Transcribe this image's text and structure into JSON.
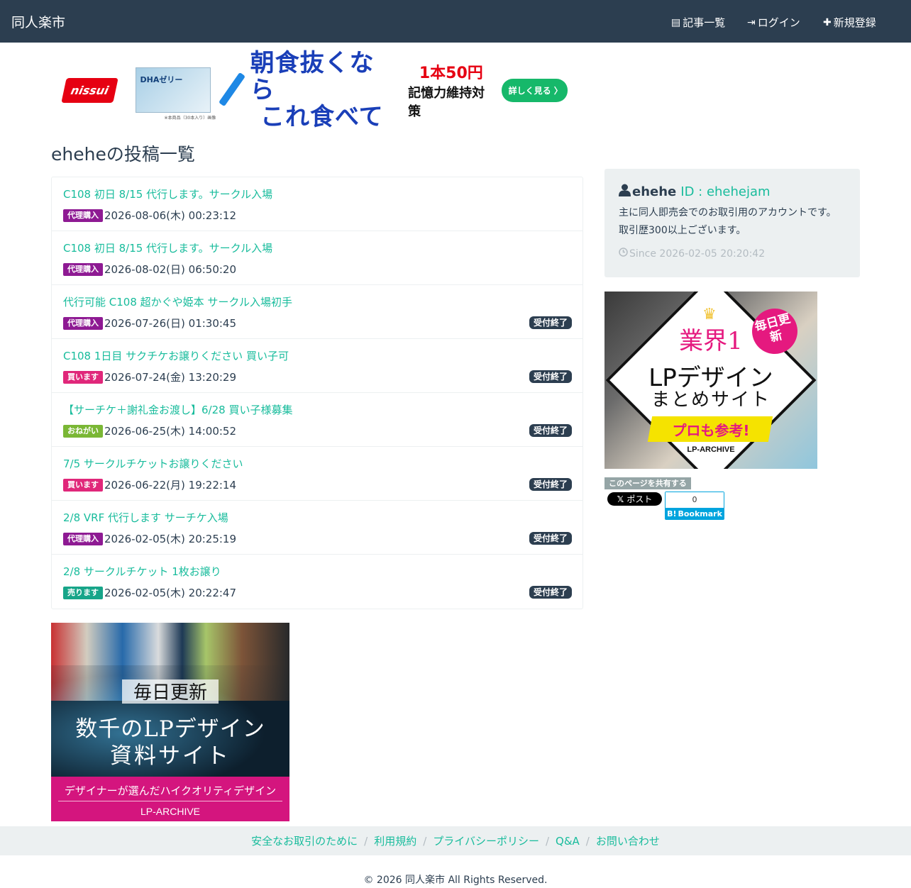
{
  "navbar": {
    "brand": "同人楽市",
    "items": [
      {
        "icon": "list-icon",
        "label": "記事一覧"
      },
      {
        "icon": "login-icon",
        "label": "ログイン"
      },
      {
        "icon": "plus-icon",
        "label": "新規登録"
      }
    ]
  },
  "top_ad": {
    "brand": "nissui",
    "product_text": "DHAゼリー",
    "product_note": "※本商品（30本入り）画像",
    "headline_1": "朝食抜くなら",
    "headline_2": "これ食べて",
    "price": "1本50円",
    "sub": "記憶力維持対策",
    "cta": "詳しく見る 〉"
  },
  "page_title": "eheheの投稿一覧",
  "posts": [
    {
      "title": "C108 初日 8/15 代行します。サークル入場",
      "category": "代理購入",
      "category_color": "#8e1a93",
      "date": "2026-08-06(木) 00:23:12",
      "status": ""
    },
    {
      "title": "C108 初日 8/15 代行します。サークル入場",
      "category": "代理購入",
      "category_color": "#8e1a93",
      "date": "2026-08-02(日) 06:50:20",
      "status": ""
    },
    {
      "title": "代行可能 C108 超かぐや姫本 サークル入場初手",
      "category": "代理購入",
      "category_color": "#8e1a93",
      "date": "2026-07-26(日) 01:30:45",
      "status": "受付終了"
    },
    {
      "title": "C108 1日目 サクチケお譲りください 買い子可",
      "category": "買います",
      "category_color": "#e0277a",
      "date": "2026-07-24(金) 13:20:29",
      "status": "受付終了"
    },
    {
      "title": "【サーチケ＋謝礼金お渡し】6/28 買い子様募集",
      "category": "おねがい",
      "category_color": "#7ab735",
      "date": "2026-06-25(木) 14:00:52",
      "status": "受付終了"
    },
    {
      "title": "7/5 サークルチケットお譲りください",
      "category": "買います",
      "category_color": "#e0277a",
      "date": "2026-06-22(月) 19:22:14",
      "status": "受付終了"
    },
    {
      "title": "2/8 VRF 代行します サーチケ入場",
      "category": "代理購入",
      "category_color": "#8e1a93",
      "date": "2026-02-05(木) 20:25:19",
      "status": "受付終了"
    },
    {
      "title": "2/8 サークルチケット 1枚お譲り",
      "category": "売ります",
      "category_color": "#17a589",
      "date": "2026-02-05(木) 20:22:47",
      "status": "受付終了"
    }
  ],
  "profile": {
    "name": "ehehe",
    "id_label": "ID : ehehejam",
    "bio": "主に同人即売会でのお取引用のアカウントです。取引歴300以上ございます。",
    "since": "Since 2026-02-05 20:20:42"
  },
  "side_ad": {
    "badge": "毎日更新",
    "top": "業界1",
    "line1": "LPデザイン",
    "line2": "まとめサイト",
    "pro": "プロも参考!",
    "brand": "LP-ARCHIVE"
  },
  "share": {
    "label": "このページを共有する",
    "x_post": "ポスト",
    "hb_count": "0",
    "hb_label": "Bookmark"
  },
  "bottom_ad": {
    "daily": "毎日更新",
    "main1": "数千のLPデザイン",
    "main2": "資料サイト",
    "band": "デザイナーが選んだハイクオリティデザイン",
    "brand": "LP-ARCHIVE"
  },
  "footer": {
    "links": [
      "安全なお取引のために",
      "利用規約",
      "プライバシーポリシー",
      "Q&A",
      "お問い合わせ"
    ],
    "copyright": "© 2026 同人楽市 All Rights Reserved."
  }
}
